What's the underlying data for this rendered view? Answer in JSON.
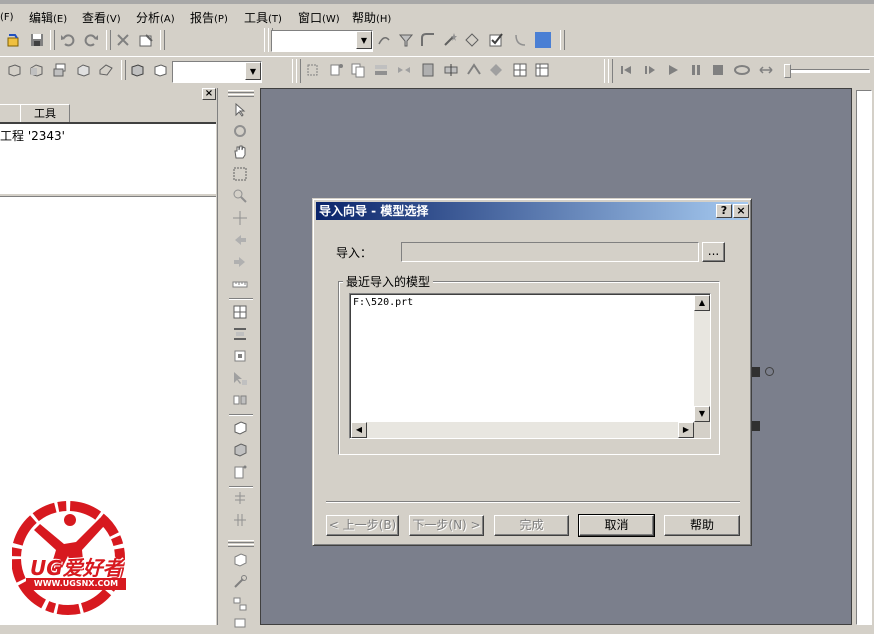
{
  "menubar": {
    "items": [
      {
        "label": "",
        "key": "(F)"
      },
      {
        "label": "编辑",
        "key": "(E)"
      },
      {
        "label": "查看",
        "key": "(V)"
      },
      {
        "label": "分析",
        "key": "(A)"
      },
      {
        "label": "报告",
        "key": "(P)"
      },
      {
        "label": "工具",
        "key": "(T)"
      },
      {
        "label": "窗口",
        "key": "(W)"
      },
      {
        "label": "帮助",
        "key": "(H)"
      }
    ]
  },
  "left_panel": {
    "tabs": [
      "",
      "工具"
    ],
    "tree_item": "工程 '2343'"
  },
  "dialog": {
    "title": "导入向导 - 模型选择",
    "help_btn": "?",
    "close_btn": "×",
    "import_label": "导入：",
    "import_value": "",
    "browse_label": "...",
    "group_label": "最近导入的模型",
    "recent_models": [
      "F:\\520.prt"
    ],
    "buttons": {
      "back": "< 上一步(B)",
      "next": "下一步(N) >",
      "finish": "完成",
      "cancel": "取消",
      "help": "帮助"
    }
  },
  "watermark": {
    "brand": "UG爱好者",
    "url": "WWW.UGSNX.COM"
  },
  "colors": {
    "workspace": "#7b7f8c",
    "title_bar": "#0a246a",
    "window_bg": "#d4d0c8",
    "accent_square": "#4a7fd4",
    "logo_red": "#d7191f"
  }
}
